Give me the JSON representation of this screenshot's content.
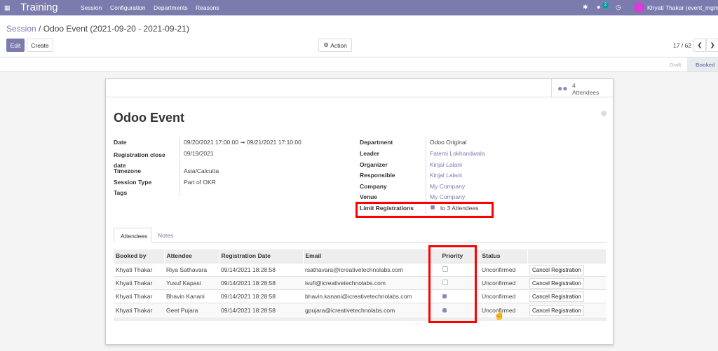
{
  "navbar": {
    "app": "Training",
    "menu": [
      "Session",
      "Configuration",
      "Departments",
      "Reasons"
    ],
    "chat_badge": "2",
    "user": "Khyati Thakar (event_mgmt"
  },
  "breadcrumb": {
    "parent": "Session",
    "current": "Odoo Event (2021-09-20 - 2021-09-21)"
  },
  "toolbar": {
    "edit": "Edit",
    "create": "Create",
    "action": "Action",
    "pager": "17 / 62"
  },
  "statusbar": {
    "stages": [
      "Draft",
      "Booked"
    ],
    "active": "Booked"
  },
  "smart_button": {
    "count": "4",
    "label": "Attendees"
  },
  "form": {
    "title": "Odoo Event",
    "left": [
      {
        "label": "Date",
        "value": "09/20/2021 17:00:00",
        "value2": "09/21/2021 17:10:00"
      },
      {
        "label": "Registration close date",
        "value": "09/19/2021"
      },
      {
        "label": "Timezone",
        "value": "Asia/Calcutta"
      },
      {
        "label": "Session Type",
        "value": "Part of OKR"
      },
      {
        "label": "Tags",
        "value": ""
      }
    ],
    "right": [
      {
        "label": "Department",
        "value": "Odoo Original"
      },
      {
        "label": "Leader",
        "value": "Fatemi Lokhandwala"
      },
      {
        "label": "Organizer",
        "value": "Kinjal Lalani"
      },
      {
        "label": "Responsible",
        "value": "Kinjal Lalani"
      },
      {
        "label": "Company",
        "value": "My Company"
      },
      {
        "label": "Venue",
        "value": "My Company"
      },
      {
        "label": "Limit Registrations",
        "value": "to 3 Attendees",
        "checked": true
      }
    ]
  },
  "tabs": [
    "Attendees",
    "Notes"
  ],
  "table": {
    "headers": [
      "Booked by",
      "Attendee",
      "Registration Date",
      "Email",
      "Priority",
      "Status",
      ""
    ],
    "rows": [
      {
        "booked_by": "Khyati Thakar",
        "attendee": "Riya Sathavara",
        "date": "09/14/2021 18:28:58",
        "email": "rsathavara@icreativetechnolabs.com",
        "priority": false,
        "status": "Unconfirmed",
        "action": "Cancel Registration"
      },
      {
        "booked_by": "Khyati Thakar",
        "attendee": "Yusuf Kapasi",
        "date": "09/14/2021 18:28:58",
        "email": "isufi@icreativetechnolabs.com",
        "priority": false,
        "status": "Unconfirmed",
        "action": "Cancel Registration"
      },
      {
        "booked_by": "Khyati Thakar",
        "attendee": "Bhavin Kanani",
        "date": "09/14/2021 18:28:58",
        "email": "bhavin.kanani@icreativetechnolabs.com",
        "priority": true,
        "status": "Unconfirmed",
        "action": "Cancel Registration"
      },
      {
        "booked_by": "Khyati Thakar",
        "attendee": "Geet Pujara",
        "date": "09/14/2021 18:28:58",
        "email": "gpujara@icreativetechnolabs.com",
        "priority": true,
        "status": "Unconfirmed",
        "action": "Cancel Registration"
      }
    ]
  },
  "colors": {
    "brand": "#7c7bad",
    "highlight": "#ff0000"
  }
}
